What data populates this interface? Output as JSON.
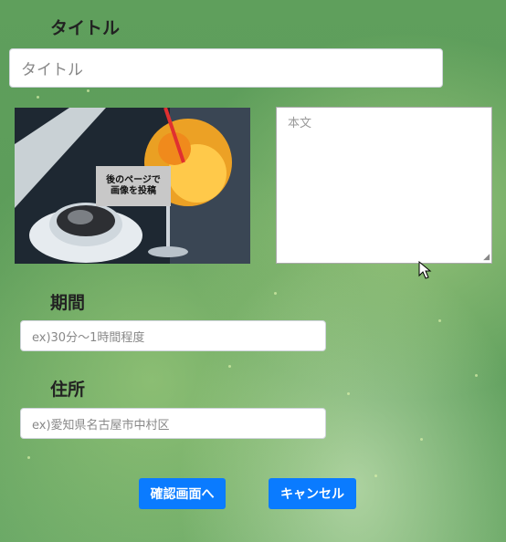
{
  "title_section": {
    "label": "タイトル",
    "placeholder": "タイトル"
  },
  "image_area": {
    "overlay_text": "後のページで\n画像を投稿"
  },
  "body_textarea": {
    "placeholder": "本文"
  },
  "period_section": {
    "label": "期間",
    "placeholder": "ex)30分〜1時間程度"
  },
  "address_section": {
    "label": "住所",
    "placeholder": "ex)愛知県名古屋市中村区"
  },
  "buttons": {
    "confirm": "確認画面へ",
    "cancel": "キャンセル"
  },
  "colors": {
    "accent": "#0a7bff",
    "background": "#5f9f5c"
  }
}
